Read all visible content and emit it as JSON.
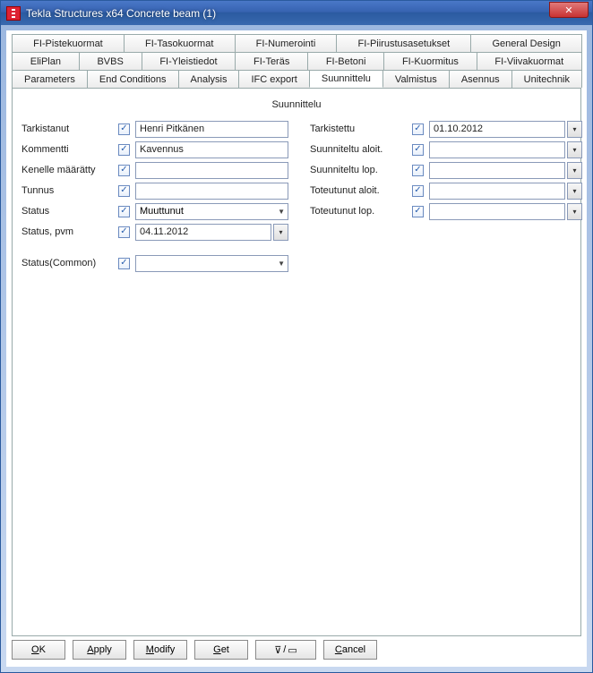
{
  "window": {
    "title": "Tekla Structures x64  Concrete beam (1)"
  },
  "tabs": {
    "row1": [
      "FI-Pistekuormat",
      "FI-Tasokuormat",
      "FI-Numerointi",
      "FI-Piirustusasetukset",
      "General Design"
    ],
    "row2": [
      "EliPlan",
      "BVBS",
      "FI-Yleistiedot",
      "FI-Teräs",
      "FI-Betoni",
      "FI-Kuormitus",
      "FI-Viivakuormat"
    ],
    "row3": [
      "Parameters",
      "End Conditions",
      "Analysis",
      "IFC export",
      "Suunnittelu",
      "Valmistus",
      "Asennus",
      "Unitechnik"
    ],
    "active": "Suunnittelu"
  },
  "page": {
    "title": "Suunnittelu"
  },
  "left": {
    "tarkistanut": {
      "label": "Tarkistanut",
      "checked": true,
      "value": "Henri Pitkänen"
    },
    "kommentti": {
      "label": "Kommentti",
      "checked": true,
      "value": "Kavennus"
    },
    "kenelle": {
      "label": "Kenelle määrätty",
      "checked": true,
      "value": ""
    },
    "tunnus": {
      "label": "Tunnus",
      "checked": true,
      "value": ""
    },
    "status": {
      "label": "Status",
      "checked": true,
      "value": "Muuttunut"
    },
    "statuspvm": {
      "label": "Status, pvm",
      "checked": true,
      "value": "04.11.2012"
    },
    "statuscommon": {
      "label": "Status(Common)",
      "checked": true,
      "value": ""
    }
  },
  "right": {
    "tarkistettu": {
      "label": "Tarkistettu",
      "checked": true,
      "value": "01.10.2012"
    },
    "suun_aloit": {
      "label": "Suunniteltu aloit.",
      "checked": true,
      "value": ""
    },
    "suun_lop": {
      "label": "Suunniteltu lop.",
      "checked": true,
      "value": ""
    },
    "tot_aloit": {
      "label": "Toteutunut aloit.",
      "checked": true,
      "value": ""
    },
    "tot_lop": {
      "label": "Toteutunut lop.",
      "checked": true,
      "value": ""
    }
  },
  "buttons": {
    "ok": "OK",
    "apply": "Apply",
    "modify": "Modify",
    "get": "Get",
    "cancel": "Cancel"
  }
}
